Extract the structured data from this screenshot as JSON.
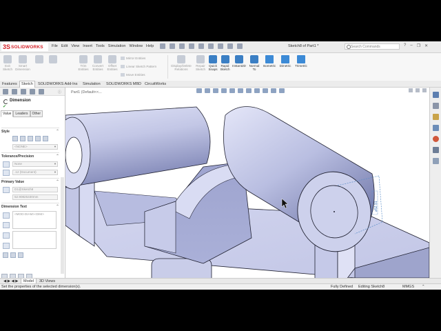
{
  "app": {
    "logo_mark": "3S",
    "logo_text": "SOLIDWORKS",
    "menu": [
      "File",
      "Edit",
      "View",
      "Insert",
      "Tools",
      "Simulation",
      "Window",
      "Help"
    ],
    "document_title": "Sketch8 of Part1 *",
    "search_placeholder": "Search Commands",
    "window_controls": [
      "?",
      "–",
      "❐",
      "✕"
    ]
  },
  "ribbon": {
    "sketch_groups": [
      {
        "label": "Exit Sketch",
        "state": "disabled"
      },
      {
        "label": "Smart Dimension",
        "state": "disabled"
      },
      {
        "label": "Trim Entities",
        "state": "disabled"
      },
      {
        "label": "Convert Entities",
        "state": "disabled"
      },
      {
        "label": "Offset Entities",
        "state": "disabled"
      }
    ],
    "small_tools": [
      "Mirror Entities",
      "Linear Sketch Pattern",
      "Move Entities"
    ],
    "relations_label": "Display/Delete Relations",
    "repair_label": "Repair Sketch",
    "quick_snaps_label": "Quick Snaps",
    "rapid_sketch_label": "Rapid Sketch",
    "instant2d_label": "Instant2D",
    "normal_to_label": "Normal To",
    "views": [
      "Isometric",
      "Dimetric",
      "Trimetric"
    ]
  },
  "tabs": [
    "Features",
    "Sketch",
    "SOLIDWORKS Add-Ins",
    "Simulation",
    "SOLIDWORKS MBD",
    "CircuitWorks"
  ],
  "active_tab": "Sketch",
  "property_manager": {
    "title": "Dimension",
    "info_icon": "ⓘ",
    "ok_glyph": "✔",
    "subtabs": [
      "Value",
      "Leaders",
      "Other"
    ],
    "active_subtab": "Value",
    "sections": {
      "style": "Style",
      "style_value": "<NONE>",
      "tolerance": "Tolerance/Precision",
      "tolerance_value": "None",
      "precision_value": ".12 (Document)",
      "primary_value": "Primary Value",
      "primary_name": "D1@Sketch8",
      "primary_number": "52.90825330mm",
      "dimension_text": "Dimension Text",
      "dimension_text_value": "<MOD-DIAM><DIM>"
    }
  },
  "viewport": {
    "tree_label": "Part1 (Default<<..."
  },
  "model_tabs": [
    "Model",
    "3D Views"
  ],
  "active_model_tab": "Model",
  "status": {
    "hint": "Set the properties of the selected dimension(s).",
    "state": "Fully Defined",
    "editing": "Editing Sketch8",
    "units": "MMGS"
  },
  "colors": {
    "brand": "#d42027",
    "part_face": "#c3c7e6",
    "accent": "#3b7fc4"
  }
}
